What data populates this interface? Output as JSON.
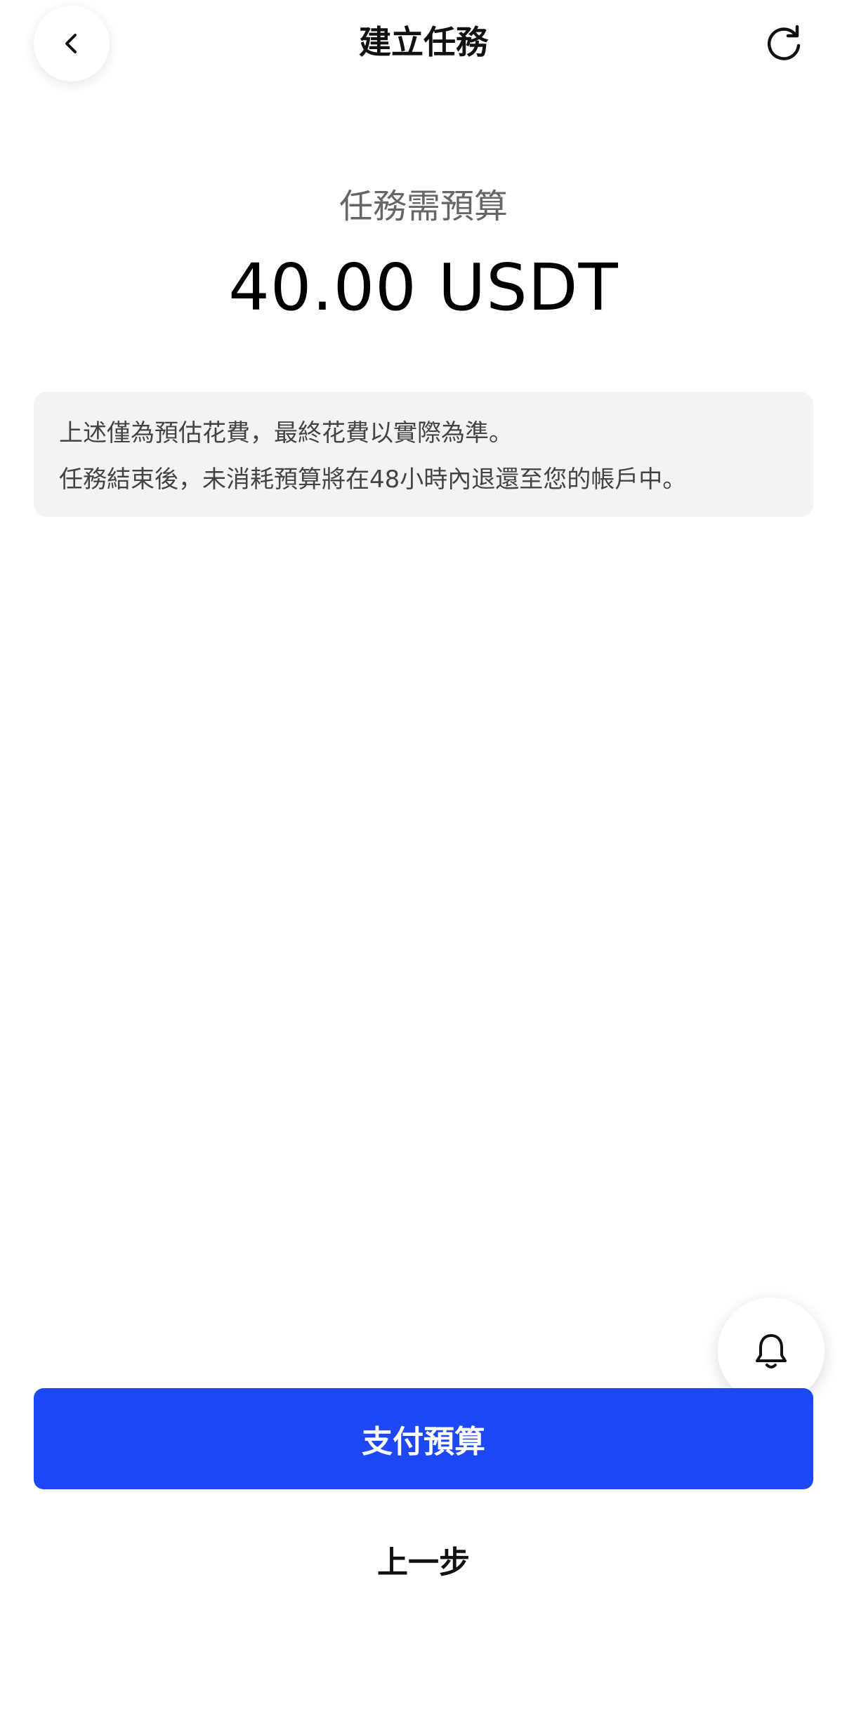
{
  "header": {
    "title": "建立任務",
    "back_icon": "chevron-left-icon",
    "refresh_icon": "refresh-icon"
  },
  "budget": {
    "label": "任務需預算",
    "amount": "40.00 USDT"
  },
  "notice": {
    "line1": "上述僅為預估花費，最終花費以實際為準。",
    "line2": "任務結束後，未消耗預算將在48小時內退還至您的帳戶中。"
  },
  "actions": {
    "pay_label": "支付預算",
    "prev_label": "上一步"
  },
  "fab": {
    "icon": "bell-icon"
  },
  "colors": {
    "primary": "#1e47f5",
    "notice_bg": "#f3f3f3",
    "muted_text": "#666666"
  }
}
